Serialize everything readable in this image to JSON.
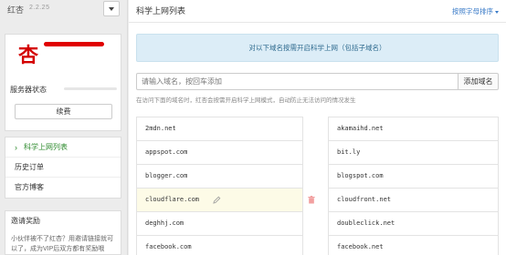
{
  "app": {
    "name": "红杏",
    "version": "2.2.25"
  },
  "account": {
    "avatar_char": "杏",
    "status_label": "服务器状态",
    "renew_label": "续费"
  },
  "nav": {
    "items": [
      {
        "label": "科学上网列表",
        "active": true
      },
      {
        "label": "历史订单",
        "active": false
      },
      {
        "label": "官方博客",
        "active": false
      }
    ]
  },
  "invite": {
    "title": "邀请奖励",
    "text": "小伙伴被不了红杏？用邀请链接就可以了，成为VIP后双方都有奖励哦"
  },
  "main": {
    "title": "科学上网列表",
    "sort_label": "按照字母排序",
    "banner": "对以下域名按需开启科学上网（包括子域名）",
    "input_placeholder": "请输入域名，按回车添加",
    "add_button": "添加域名",
    "hint": "在访问下面的域名时，红杏会按需开启科学上网模式，自动防止无法访问的情况发生"
  },
  "domains_left": [
    "2mdn.net",
    "appspot.com",
    "blogger.com",
    "cloudflare.com",
    "deghhj.com",
    "facebook.com"
  ],
  "domains_right": [
    "akamaihd.net",
    "bit.ly",
    "blogspot.com",
    "cloudfront.net",
    "doubleclick.net",
    "facebook.net"
  ],
  "colors": {
    "accent": "#2e8b2e",
    "link": "#3a7bc8",
    "brand_red": "#d40000",
    "banner_bg": "#dcedf7"
  }
}
